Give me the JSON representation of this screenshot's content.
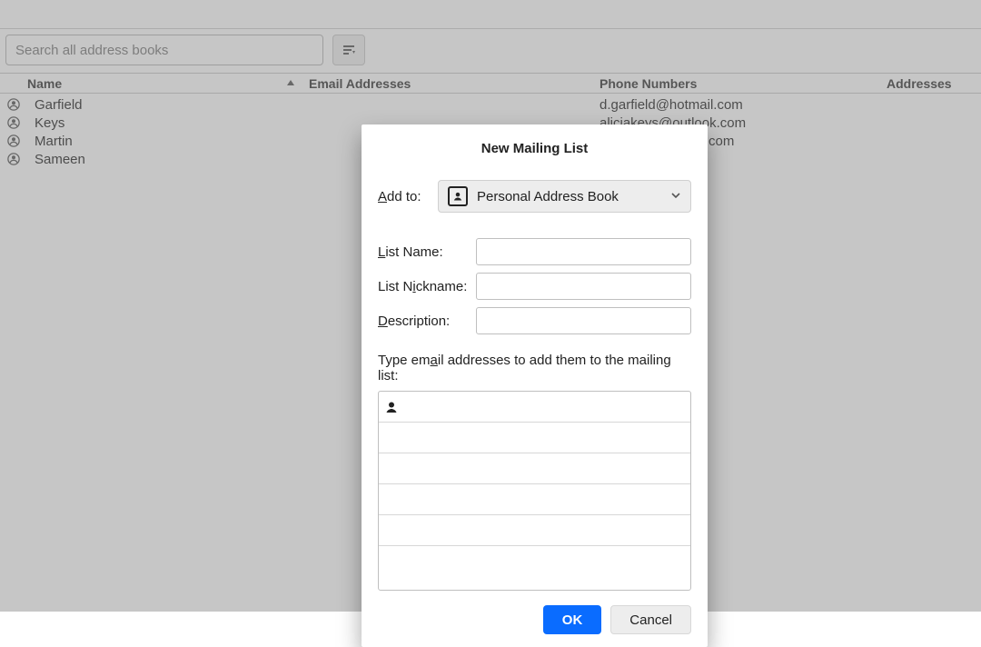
{
  "toolbar": {
    "search_placeholder": "Search all address books"
  },
  "columns": {
    "name": "Name",
    "email": "Email Addresses",
    "phone": "Phone Numbers",
    "addresses": "Addresses"
  },
  "contacts": [
    {
      "name": "Garfield",
      "email": "d.garfield@hotmail.com"
    },
    {
      "name": "Keys",
      "email": "aliciakeys@outlook.com"
    },
    {
      "name": "Martin",
      "email": "com"
    },
    {
      "name": "Sameen",
      "email": ""
    }
  ],
  "dialog": {
    "title": "New Mailing List",
    "add_to_label_pre": "A",
    "add_to_label_post": "dd to:",
    "add_to_value": "Personal Address Book",
    "list_name_label_pre": "L",
    "list_name_label_post": "ist Name:",
    "list_name_value": "",
    "nickname_label_pre": "List N",
    "nickname_label_underline": "i",
    "nickname_label_post": "ckname:",
    "nickname_value": "",
    "description_label_pre": "D",
    "description_label_post": "escription:",
    "description_value": "",
    "instructions_pre": "Type em",
    "instructions_underline": "a",
    "instructions_post": "il addresses to add them to the mailing list:",
    "ok_label": "OK",
    "cancel_label": "Cancel"
  }
}
